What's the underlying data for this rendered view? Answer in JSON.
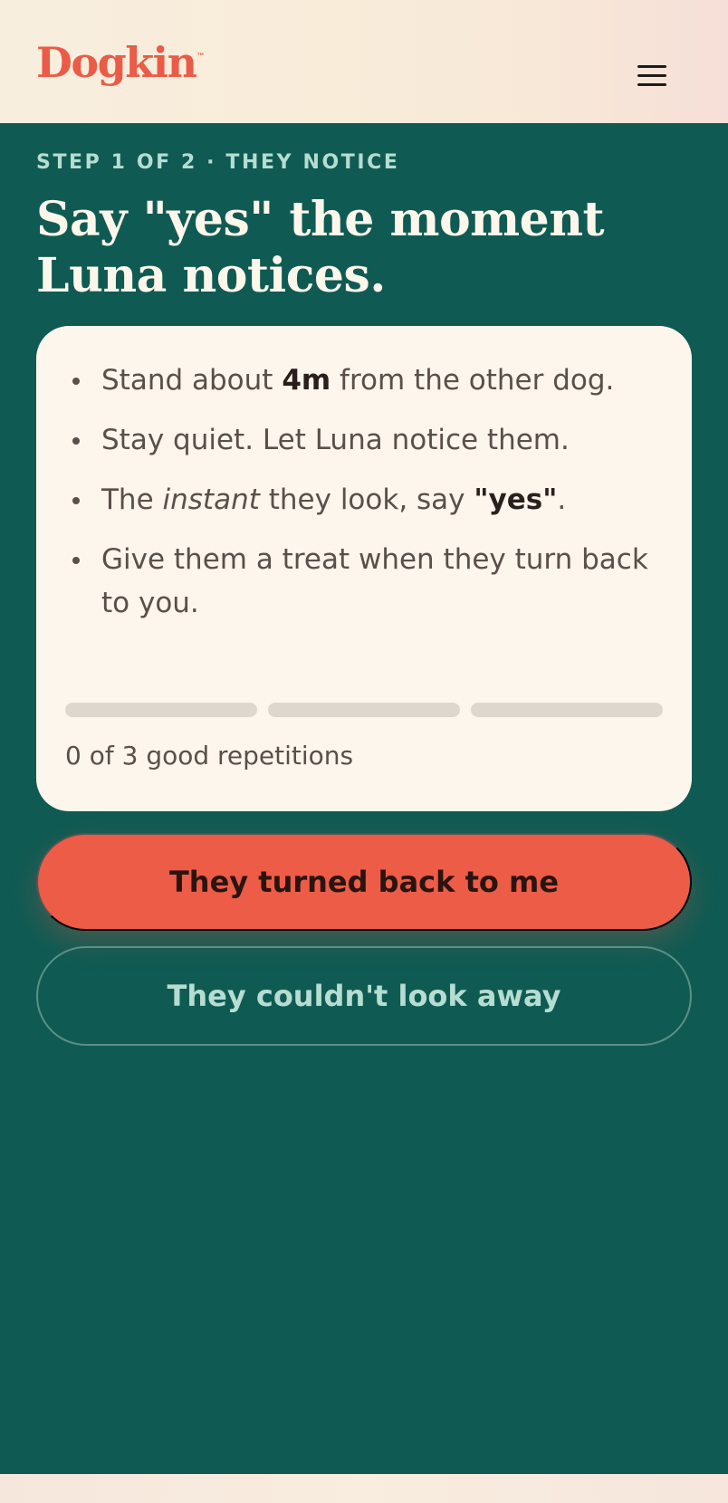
{
  "header": {
    "logo_text": "Dogkin",
    "logo_mark": "™",
    "menu_icon": "hamburger-menu-icon"
  },
  "step": {
    "label": "STEP 1 OF 2 · THEY NOTICE",
    "headline": "Say \"yes\" the moment Luna notices."
  },
  "instructions": {
    "items": [
      {
        "before": "Stand about ",
        "bold": "4m",
        "after": " from the other dog."
      },
      {
        "text": "Stay quiet. Let Luna notice them."
      },
      {
        "before": "The ",
        "italic": "instant",
        "middle": " they look, say ",
        "bold": "\"yes\"",
        "after": "."
      },
      {
        "text": "Give them a treat when they turn back to you."
      }
    ],
    "progress": {
      "completed": 0,
      "total": 3,
      "label": "0 of 3 good repetitions"
    }
  },
  "actions": {
    "primary_label": "They turned back to me",
    "secondary_label": "They couldn't look away"
  },
  "colors": {
    "background": "#0f5b53",
    "accent": "#ec5c47",
    "card": "#fdf6ec",
    "muted_teal": "#b6ddd2"
  }
}
